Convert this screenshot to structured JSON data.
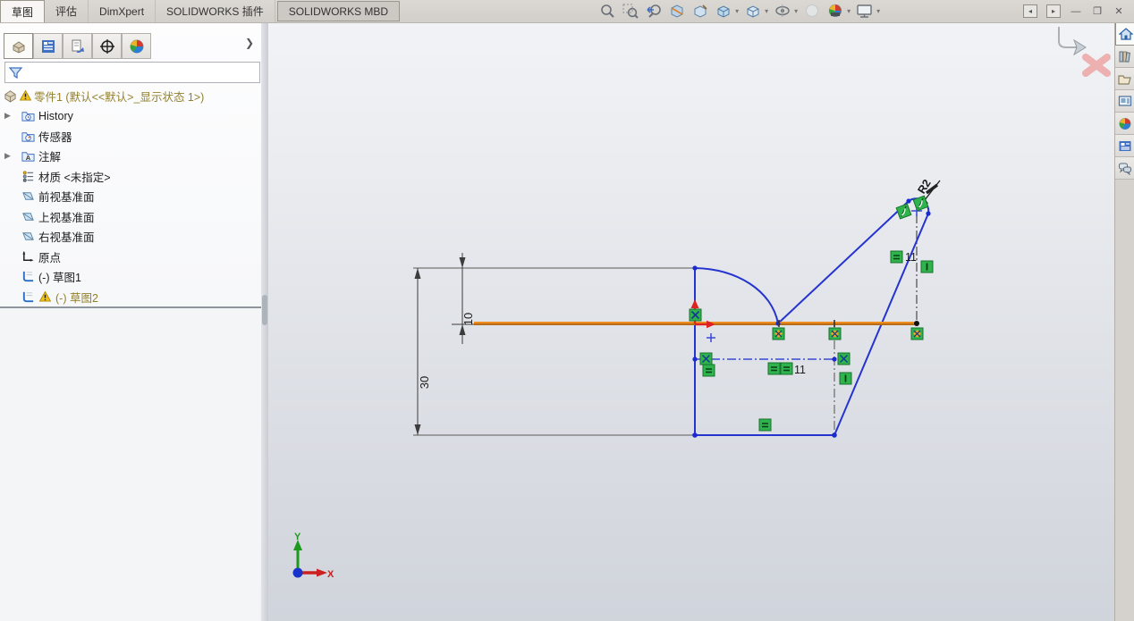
{
  "ribbon": {
    "tabs": [
      {
        "label": "草图",
        "active": true
      },
      {
        "label": "评估",
        "active": false
      },
      {
        "label": "DimXpert",
        "active": false
      },
      {
        "label": "SOLIDWORKS 插件",
        "active": false
      },
      {
        "label": "SOLIDWORKS MBD",
        "active": false
      }
    ]
  },
  "view_toolbar": {
    "icons": [
      "zoom-to-fit",
      "zoom-to-area",
      "previous-view",
      "section-view",
      "3d-drawing-view",
      "view-orientation",
      "display-style",
      "hide-show-items",
      "edit-appearance",
      "apply-scene",
      "view-settings"
    ]
  },
  "window_controls": [
    "collapse-left",
    "collapse-right",
    "minimize",
    "restore",
    "close"
  ],
  "left_panel": {
    "manager_tabs": [
      "featuremanager-design-tree",
      "propertymanager",
      "configurationmanager",
      "dimxpertmanager",
      "displaymanager"
    ],
    "filter": {
      "value": "",
      "icon": "filter-funnel-icon"
    },
    "tree": {
      "items": [
        {
          "label": "零件1 (默认<<默认>_显示状态 1>)",
          "icon": "part",
          "warning": true,
          "olive": true
        },
        {
          "label": "History",
          "icon": "history-folder",
          "expand": true
        },
        {
          "label": "传感器",
          "icon": "sensors-folder"
        },
        {
          "label": "注解",
          "icon": "annotations-folder",
          "expand": true
        },
        {
          "label": "材质 <未指定>",
          "icon": "material"
        },
        {
          "label": "前视基准面",
          "icon": "plane"
        },
        {
          "label": "上视基准面",
          "icon": "plane"
        },
        {
          "label": "右视基准面",
          "icon": "plane"
        },
        {
          "label": "原点",
          "icon": "origin"
        },
        {
          "label": "(-) 草图1",
          "icon": "sketch"
        },
        {
          "label": "(-) 草图2",
          "icon": "sketch",
          "warning": true,
          "olive": true
        }
      ]
    }
  },
  "task_pane": {
    "icons": [
      "home",
      "design-library",
      "file-explorer",
      "view-palette",
      "appearances-scenes",
      "custom-properties",
      "solidworks-forum"
    ]
  },
  "sketch": {
    "dimensions": {
      "total_height": "30",
      "offset_height": "10",
      "bottom_width": "11",
      "right_height": "11",
      "fillet_radius": "R2"
    },
    "colors": {
      "sketch_line": "#2634cf",
      "selected_line": "#ef8c1e",
      "constraint_green": "#2eb34d",
      "dimension_text": "#1a1a1a"
    }
  },
  "triad": {
    "x": "X",
    "y": "Y"
  }
}
